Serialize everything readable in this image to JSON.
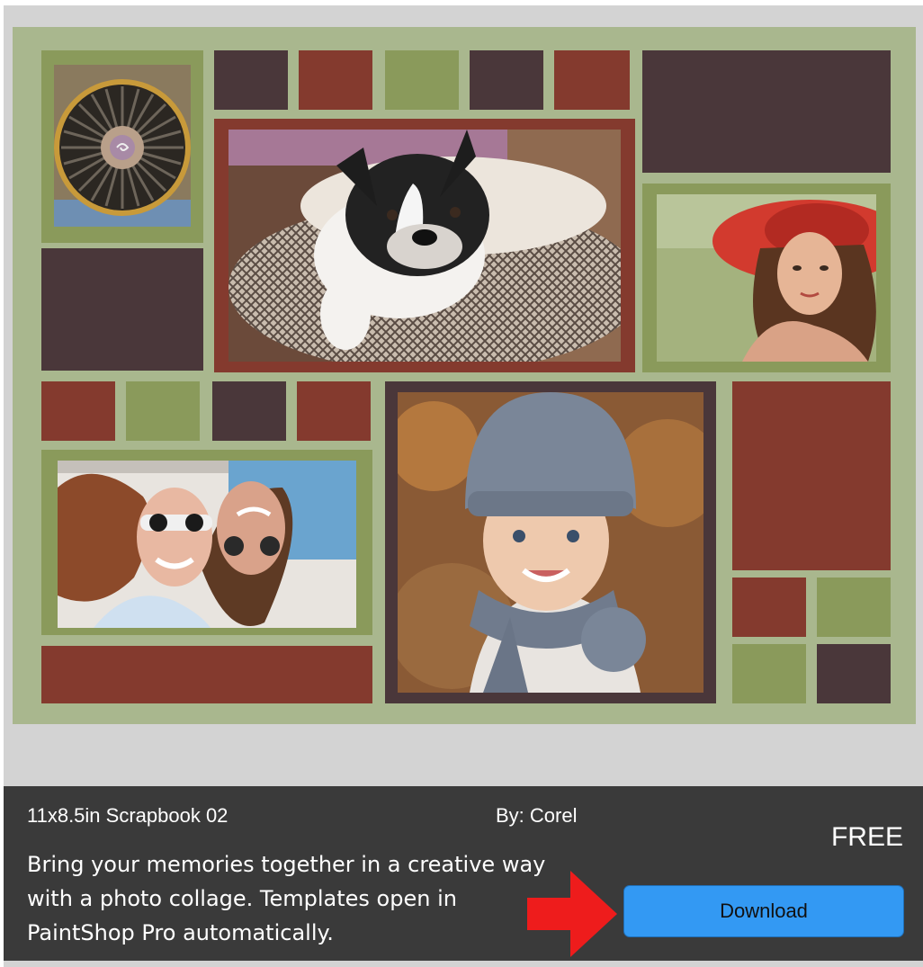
{
  "template": {
    "title": "11x8.5in Scrapbook 02",
    "author": "By: Corel",
    "price": "FREE",
    "description": "Bring your memories together in a creative way with a photo collage. Templates open in PaintShop Pro automatically.",
    "download_label": "Download"
  },
  "colors": {
    "background_green": "#a9b78e",
    "plum": "#4a373a",
    "rust": "#843a2e",
    "olive": "#8a9a5b",
    "info_bar": "#3a3a3a",
    "download_button": "#3399f3",
    "arrow": "#ee1c1c"
  },
  "photos": [
    {
      "subject": "jet engine turbine"
    },
    {
      "subject": "french bulldog on knitted cushion"
    },
    {
      "subject": "woman in red sun hat"
    },
    {
      "subject": "couple lying down wearing sunglasses"
    },
    {
      "subject": "smiling child in knit hat and scarf"
    }
  ],
  "icons": {
    "pointer": "red-arrow-icon"
  }
}
